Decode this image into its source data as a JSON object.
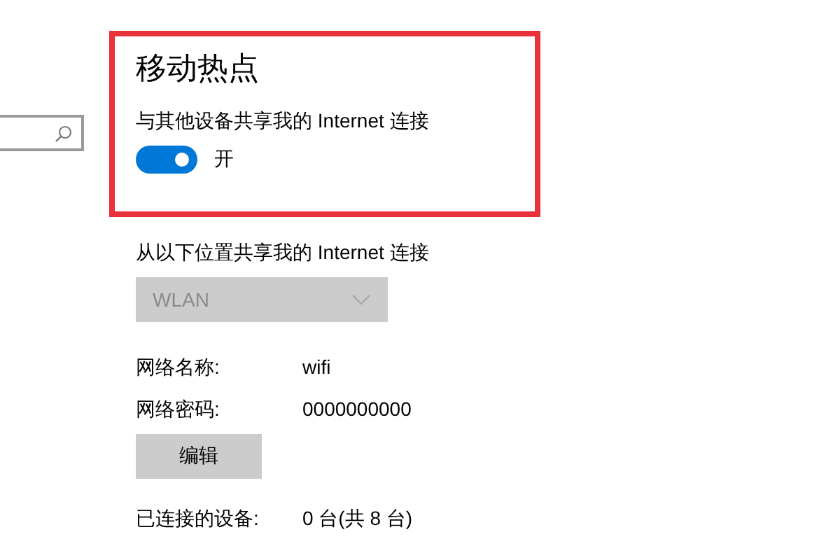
{
  "hotspot": {
    "title": "移动热点",
    "share_label": "与其他设备共享我的 Internet 连接",
    "toggle": {
      "on": true,
      "label": "开"
    }
  },
  "source": {
    "label": "从以下位置共享我的 Internet 连接",
    "dropdown": {
      "value": "WLAN",
      "disabled": true
    }
  },
  "fields": [
    {
      "label": "网络名称:",
      "value": "wifi"
    },
    {
      "label": "网络密码:",
      "value": "0000000000"
    }
  ],
  "edit_button": "编辑",
  "connected": {
    "label": "已连接的设备:",
    "value": "0 台(共 8 台)"
  }
}
